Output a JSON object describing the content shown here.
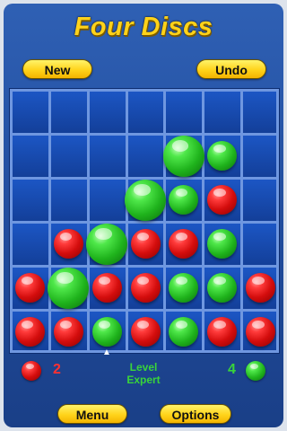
{
  "game": {
    "title": "Four Discs",
    "buttons": {
      "new": "New",
      "undo": "Undo",
      "menu": "Menu",
      "options": "Options"
    },
    "board": {
      "columns": 7,
      "rows": 6,
      "cells": [
        [
          "",
          "",
          "",
          "",
          "",
          "",
          ""
        ],
        [
          "",
          "",
          "",
          "",
          "green",
          "green",
          ""
        ],
        [
          "",
          "",
          "",
          "green",
          "green",
          "red",
          ""
        ],
        [
          "",
          "red",
          "green",
          "red",
          "red",
          "green",
          ""
        ],
        [
          "red",
          "green",
          "red",
          "red",
          "green",
          "green",
          "red"
        ],
        [
          "red",
          "red",
          "green",
          "red",
          "green",
          "red",
          "red"
        ]
      ],
      "large_discs": [
        [
          1,
          4
        ],
        [
          2,
          3
        ],
        [
          3,
          2
        ],
        [
          4,
          1
        ]
      ]
    },
    "status": {
      "red_score": "2",
      "green_score": "4",
      "level_label": "Level",
      "level_value": "Expert"
    },
    "colors": {
      "red": "#d40d0d",
      "green": "#1fb31c",
      "button_yellow": "#ffd31a",
      "board_blue": "#1746a7",
      "grid_line": "#6f97e0"
    },
    "pointer_icon": "arrow-up-icon"
  }
}
